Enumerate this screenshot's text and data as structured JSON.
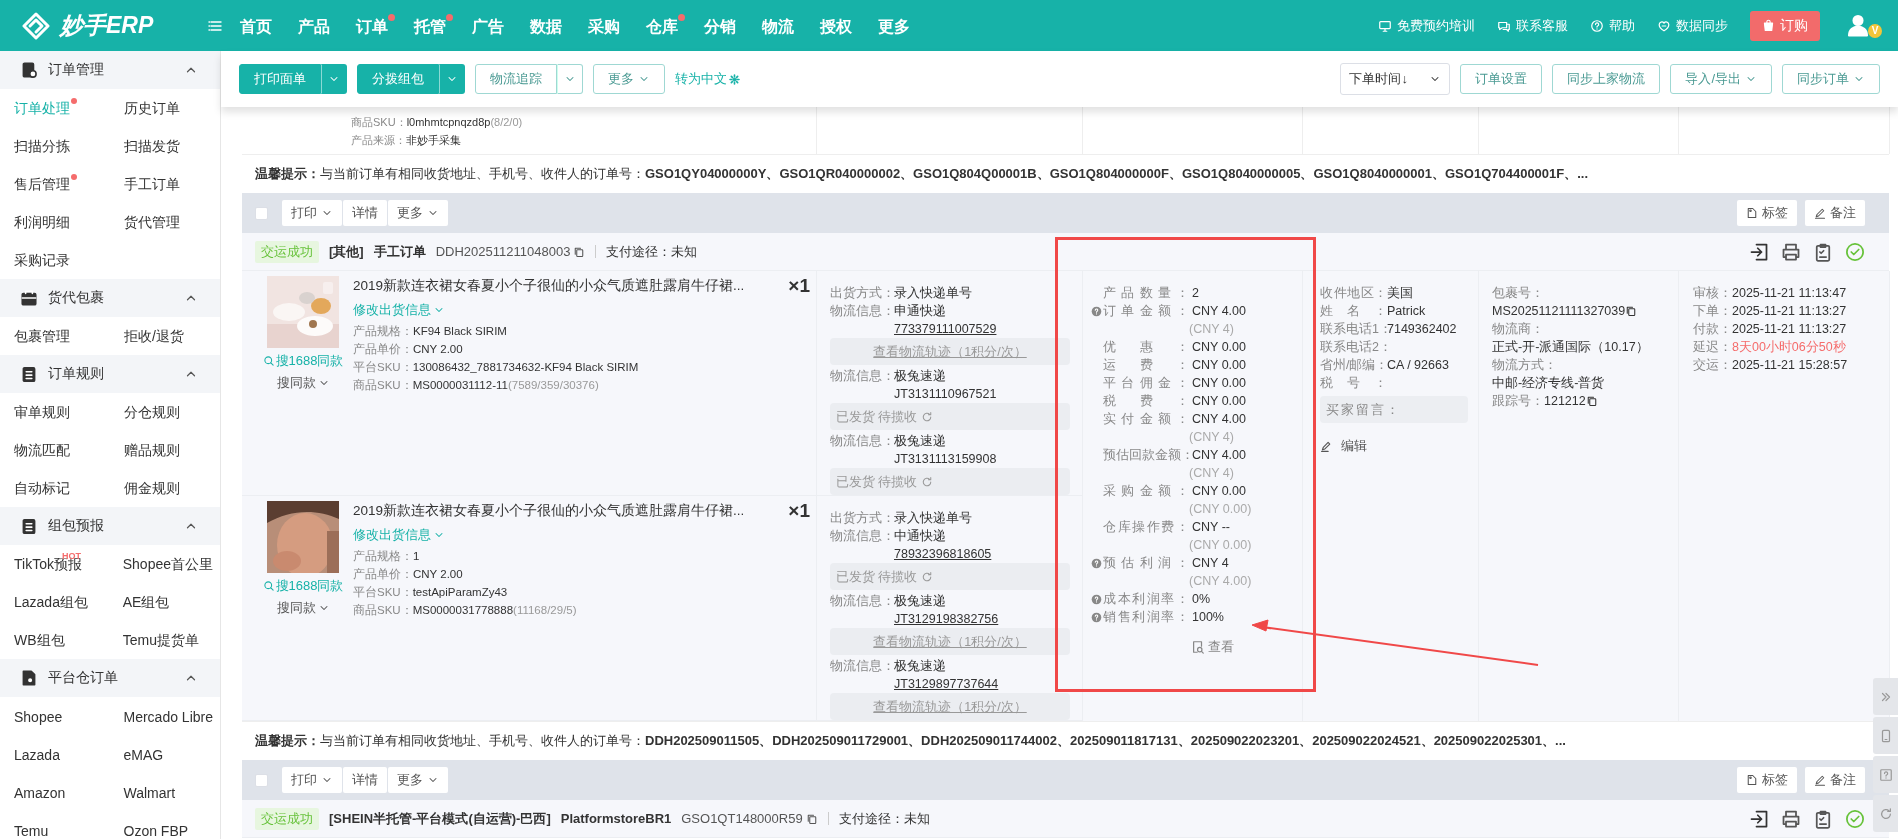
{
  "header": {
    "logo": "妙手ERP",
    "nav": [
      {
        "label": "首页",
        "badge": false
      },
      {
        "label": "产品",
        "badge": false
      },
      {
        "label": "订单",
        "badge": true
      },
      {
        "label": "托管",
        "badge": true
      },
      {
        "label": "广告",
        "badge": false
      },
      {
        "label": "数据",
        "badge": false
      },
      {
        "label": "采购",
        "badge": false
      },
      {
        "label": "仓库",
        "badge": true
      },
      {
        "label": "分销",
        "badge": false
      },
      {
        "label": "物流",
        "badge": false
      },
      {
        "label": "授权",
        "badge": false
      },
      {
        "label": "更多",
        "badge": false
      }
    ],
    "links": [
      "免费预约培训",
      "联系客服",
      "帮助",
      "数据同步"
    ],
    "buy": "订购",
    "vip": "V"
  },
  "sidebar": [
    {
      "title": "订单管理",
      "expanded": true,
      "items": [
        {
          "label": "订单处理",
          "selected": true,
          "badge": true
        },
        {
          "label": "历史订单",
          "selected": false,
          "badge": false
        },
        {
          "label": "扫描分拣",
          "selected": false,
          "badge": false
        },
        {
          "label": "扫描发货",
          "selected": false,
          "badge": false
        },
        {
          "label": "售后管理",
          "selected": false,
          "badge": true
        },
        {
          "label": "手工订单",
          "selected": false,
          "badge": false
        },
        {
          "label": "利润明细",
          "selected": false,
          "badge": false
        },
        {
          "label": "货代管理",
          "selected": false,
          "badge": false
        },
        {
          "label": "采购记录",
          "selected": false,
          "badge": false
        }
      ]
    },
    {
      "title": "货代包裹",
      "expanded": true,
      "items": [
        {
          "label": "包裹管理",
          "selected": false,
          "badge": false
        },
        {
          "label": "拒收/退货",
          "selected": false,
          "badge": false
        }
      ]
    },
    {
      "title": "订单规则",
      "expanded": true,
      "items": [
        {
          "label": "审单规则",
          "selected": false,
          "badge": false
        },
        {
          "label": "分仓规则",
          "selected": false,
          "badge": false
        },
        {
          "label": "物流匹配",
          "selected": false,
          "badge": false
        },
        {
          "label": "赠品规则",
          "selected": false,
          "badge": false
        },
        {
          "label": "自动标记",
          "selected": false,
          "badge": false
        },
        {
          "label": "佣金规则",
          "selected": false,
          "badge": false
        }
      ]
    },
    {
      "title": "组包预报",
      "expanded": true,
      "items": [
        {
          "label": "TikTok预报",
          "tag": "HOT",
          "selected": false,
          "badge": false
        },
        {
          "label": "Shopee首公里",
          "selected": false,
          "badge": false
        },
        {
          "label": "Lazada组包",
          "selected": false,
          "badge": false
        },
        {
          "label": "AE组包",
          "selected": false,
          "badge": false
        },
        {
          "label": "WB组包",
          "selected": false,
          "badge": false
        },
        {
          "label": "Temu提货单",
          "selected": false,
          "badge": false
        }
      ]
    },
    {
      "title": "平台仓订单",
      "expanded": true,
      "items": [
        {
          "label": "Shopee",
          "selected": false,
          "badge": false
        },
        {
          "label": "Mercado Libre",
          "selected": false,
          "badge": false
        },
        {
          "label": "Lazada",
          "selected": false,
          "badge": false
        },
        {
          "label": "eMAG",
          "selected": false,
          "badge": false
        },
        {
          "label": "Amazon",
          "selected": false,
          "badge": false
        },
        {
          "label": "Walmart",
          "selected": false,
          "badge": false
        },
        {
          "label": "Temu",
          "selected": false,
          "badge": false
        },
        {
          "label": "Ozon FBP",
          "selected": false,
          "badge": false
        }
      ]
    }
  ],
  "toolbar": {
    "left": [
      {
        "label": "打印面单",
        "kind": "primary-split"
      },
      {
        "label": "分拨组包",
        "kind": "primary-split"
      },
      {
        "label": "物流追踪",
        "kind": "outline-split"
      },
      {
        "label": "更多",
        "kind": "outline-dropdown"
      }
    ],
    "translate": "转为中文",
    "sort": "下单时间↓",
    "right": [
      {
        "label": "订单设置",
        "kind": "outline"
      },
      {
        "label": "同步上家物流",
        "kind": "outline"
      },
      {
        "label": "导入/导出",
        "kind": "outline-dropdown"
      },
      {
        "label": "同步订单",
        "kind": "outline-dropdown"
      }
    ]
  },
  "partial_order": {
    "fields": [
      {
        "label": "商品SKU：",
        "value": "l0mhmtcpnqzd8p",
        "extra": "(8/2/0)"
      },
      {
        "label": "产品来源：",
        "value": "非妙手采集"
      }
    ]
  },
  "orders": [
    {
      "tip": "**温馨提示：** 与当前订单有相同收货地址、手机号、收件人的订单号：**GSO1QY04000000Y、GSO1QR040000002、GSO1Q804Q00001B、GSO1Q804000000F、GSO1Q8040000005、GSO1Q8040000001、GSO1Q704400001F、...**",
      "actions": {
        "checked": false,
        "print": "打印",
        "detail": "详情",
        "more": "更多",
        "tag": "标签",
        "note": "备注"
      },
      "head": {
        "status": "交运成功",
        "tags": [
          "[其他]",
          "手工订单"
        ],
        "order_no": "DDH202511211048003",
        "pay": "支付途径：未知"
      },
      "products": [
        {
          "title": "2019新款连衣裙女春夏小个子很仙的小众气质遮肚露肩牛仔裙...",
          "qty": "×1",
          "edit": "修改出货信息",
          "search": "搜1688同款",
          "similar": "搜同款",
          "fields": [
            {
              "label": "产品规格：",
              "value": "KF94 Black SIRIM"
            },
            {
              "label": "产品单价：",
              "value": "CNY 2.00"
            },
            {
              "label": "平台SKU：",
              "value": "130086432_7881734632-KF94 Black SIRIM"
            },
            {
              "label": "商品SKU：",
              "value": "MS0000031112-11",
              "extra": "(7589/359/30376)"
            }
          ],
          "shipping": {
            "label": "出货方式：",
            "method": "录入快递单号",
            "logistics": [
              {
                "label": "物流信息：",
                "carrier": "申通快递",
                "tracking": "773379111007529",
                "linked": true,
                "bar": {
                  "kind": "track",
                  "text": "查看物流轨迹（1积分/次）"
                }
              },
              {
                "label": "物流信息：",
                "carrier": "极兔速递",
                "tracking": "JT3131110967521",
                "linked": false,
                "bar": {
                  "kind": "status",
                  "text": "已发货 待揽收"
                }
              },
              {
                "label": "物流信息：",
                "carrier": "极兔速递",
                "tracking": "JT3131113159908",
                "linked": false,
                "bar": {
                  "kind": "status",
                  "text": "已发货 待揽收"
                }
              }
            ]
          }
        },
        {
          "title": "2019新款连衣裙女春夏小个子很仙的小众气质遮肚露肩牛仔裙...",
          "qty": "×1",
          "edit": "修改出货信息",
          "search": "搜1688同款",
          "similar": "搜同款",
          "fields": [
            {
              "label": "产品规格：",
              "value": "1"
            },
            {
              "label": "产品单价：",
              "value": "CNY 2.00"
            },
            {
              "label": "平台SKU：",
              "value": "testApiParamZy43"
            },
            {
              "label": "商品SKU：",
              "value": "MS0000031778888",
              "extra": "(11168/29/5)"
            }
          ],
          "shipping": {
            "label": "出货方式：",
            "method": "录入快递单号",
            "logistics": [
              {
                "label": "物流信息：",
                "carrier": "中通快递",
                "tracking": "78932396818605",
                "linked": true,
                "bar": {
                  "kind": "status",
                  "text": "已发货 待揽收"
                }
              },
              {
                "label": "物流信息：",
                "carrier": "极兔速递",
                "tracking": "JT3129198382756",
                "linked": true,
                "bar": {
                  "kind": "track",
                  "text": "查看物流轨迹（1积分/次）"
                }
              },
              {
                "label": "物流信息：",
                "carrier": "极兔速递",
                "tracking": "JT3129897737644",
                "linked": true,
                "bar": {
                  "kind": "track",
                  "text": "查看物流轨迹（1积分/次）"
                }
              }
            ]
          }
        }
      ],
      "cost": {
        "rows": [
          {
            "label": "产品数量：",
            "value": "2",
            "help": false
          },
          {
            "label": "订单金额：",
            "value": "CNY 4.00",
            "sub": "(CNY 4)",
            "help": true
          },
          {
            "label": "优惠：",
            "value": "CNY 0.00",
            "help": false
          },
          {
            "label": "运费：",
            "value": "CNY 0.00",
            "help": false
          },
          {
            "label": "平台佣金：",
            "value": "CNY 0.00",
            "help": false
          },
          {
            "label": "税费：",
            "value": "CNY 0.00",
            "help": false
          },
          {
            "label": "实付金额：",
            "value": "CNY 4.00",
            "sub": "(CNY 4)",
            "help": false
          },
          {
            "label": "预估回款金额：",
            "value": "CNY 4.00",
            "sub": "(CNY 4)",
            "help": false
          },
          {
            "label": "采购金额：",
            "value": "CNY 0.00",
            "sub": "(CNY 0.00)",
            "help": false
          },
          {
            "label": "仓库操作费：",
            "value": "CNY --",
            "sub": "(CNY 0.00)",
            "help": false
          },
          {
            "label": "预估利润：",
            "value": "CNY 4",
            "sub": "(CNY 4.00)",
            "help": true
          },
          {
            "label": "成本利润率：",
            "value": "0%",
            "help": true
          },
          {
            "label": "销售利润率：",
            "value": "100%",
            "help": true
          }
        ],
        "view": "查看"
      },
      "receiver": {
        "rows": [
          {
            "label": "收件地区：",
            "value": "美国"
          },
          {
            "label": "姓名：",
            "value": "Patrick"
          },
          {
            "label": "联系电话1：",
            "value": "7149362402"
          },
          {
            "label": "联系电话2："
          },
          {
            "label": "省州/邮编：",
            "value": "CA / 92663"
          },
          {
            "label": "税号："
          }
        ],
        "message": "买家留言：",
        "edit": "编辑"
      },
      "package": [
        {
          "label": "包裹号：",
          "value": "MS20251121111327039",
          "copy": true,
          "inline": false
        },
        {
          "label": "物流商：",
          "value": "正式-开-派通国际（10.17）",
          "copy": false,
          "inline": false
        },
        {
          "label": "物流方式：",
          "value": "中邮-经济专线-普货",
          "copy": false,
          "inline": false
        },
        {
          "label": "跟踪号：",
          "value": "121212",
          "copy": true,
          "inline": true
        }
      ],
      "times": [
        {
          "label": "审核：",
          "value": "2025-11-21 11:13:47",
          "alert": false
        },
        {
          "label": "下单：",
          "value": "2025-11-21 11:13:27",
          "alert": false
        },
        {
          "label": "付款：",
          "value": "2025-11-21 11:13:27",
          "alert": false
        },
        {
          "label": "延迟：",
          "value": "8天00小时06分50秒",
          "alert": true
        },
        {
          "label": "交运：",
          "value": "2025-11-21 15:28:57",
          "alert": false
        }
      ]
    },
    {
      "tip": "**温馨提示：** 与当前订单有相同收货地址、手机号、收件人的订单号：**DDH202509011505、DDH202509011729001、DDH202509011744002、202509011817131、202509022023201、202509022024521、202509022025301、...**",
      "actions": {
        "checked": false,
        "print": "打印",
        "detail": "详情",
        "more": "更多",
        "tag": "标签",
        "note": "备注"
      },
      "head": {
        "status": "交运成功",
        "tags": [
          "[SHEIN半托管-平台模式(自运营)-巴西]",
          "PlatformstoreBR1"
        ],
        "order_no": "GSO1QT148000R59",
        "pay": "支付途径：未知"
      }
    }
  ]
}
